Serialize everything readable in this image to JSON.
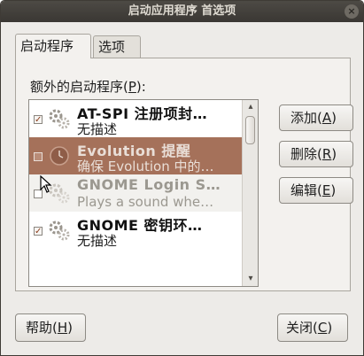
{
  "window": {
    "title": "启动应用程序 首选项",
    "close_glyph": "×"
  },
  "tabs": [
    {
      "label": "启动程序",
      "active": true
    },
    {
      "label": "选项",
      "active": false
    }
  ],
  "panel": {
    "label": "额外的启动程序(",
    "label_mnemonic": "P",
    "label_tail": "):"
  },
  "list": {
    "items": [
      {
        "checked": true,
        "name": "AT-SPI 注册项封…",
        "desc": "无描述",
        "state": "normal"
      },
      {
        "checked": false,
        "name": "Evolution 提醒",
        "desc": "确保 Evolution 中的…",
        "state": "selected"
      },
      {
        "checked": false,
        "name": "GNOME Login S…",
        "desc": "Plays a sound whe…",
        "state": "dim"
      },
      {
        "checked": true,
        "name": "GNOME 密钥环…",
        "desc": "无描述",
        "state": "normal"
      }
    ],
    "scroll_up": "▴",
    "scroll_down": "▾"
  },
  "buttons": {
    "add": {
      "label": "添加(",
      "mnemonic": "A",
      "tail": ")"
    },
    "remove": {
      "label": "删除(",
      "mnemonic": "R",
      "tail": ")"
    },
    "edit": {
      "label": "编辑(",
      "mnemonic": "E",
      "tail": ")"
    },
    "help": {
      "label": "帮助(",
      "mnemonic": "H",
      "tail": ")"
    },
    "close": {
      "label": "关闭(",
      "mnemonic": "C",
      "tail": ")"
    }
  },
  "colors": {
    "selection": "#a5715a",
    "titlebar": "#3d3a36",
    "check": "#8b3d1d"
  }
}
